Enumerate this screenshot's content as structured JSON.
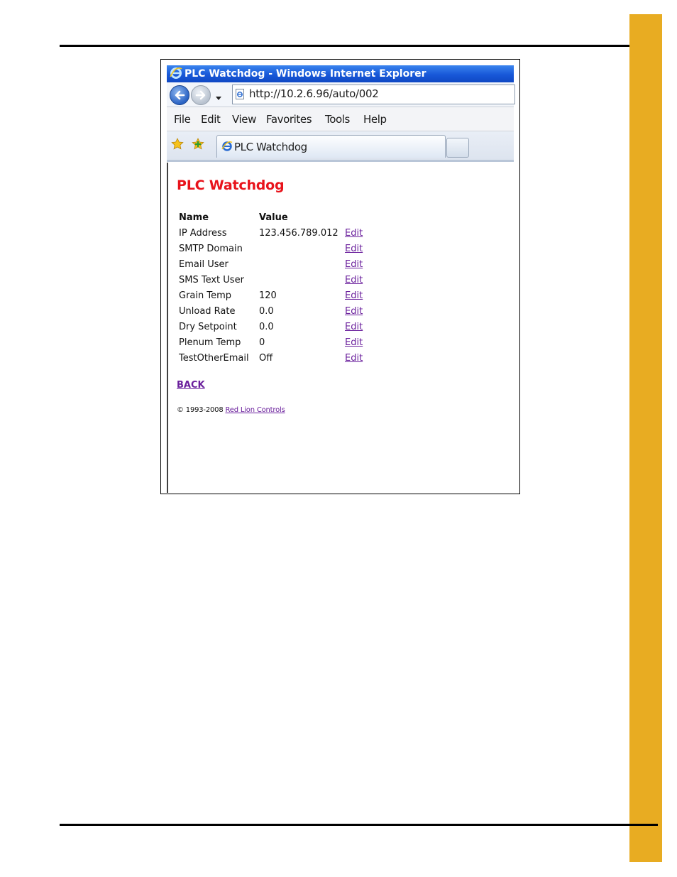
{
  "document": {
    "side_tab_color": "#e8ac22"
  },
  "window": {
    "title": "PLC Watchdog - Windows Internet Explorer"
  },
  "address_bar": {
    "url": "http://10.2.6.96/auto/002"
  },
  "menu": {
    "items": [
      {
        "label": "File"
      },
      {
        "label": "Edit"
      },
      {
        "label": "View"
      },
      {
        "label": "Favorites"
      },
      {
        "label": "Tools"
      },
      {
        "label": "Help"
      }
    ]
  },
  "tabs": {
    "active_label": "PLC Watchdog"
  },
  "page": {
    "title": "PLC Watchdog",
    "title_color": "#e8131b",
    "table": {
      "headers": {
        "name": "Name",
        "value": "Value"
      },
      "rows": [
        {
          "name": "IP Address",
          "value": "123.456.789.012",
          "action": "Edit"
        },
        {
          "name": "SMTP Domain",
          "value": "",
          "action": "Edit"
        },
        {
          "name": "Email User",
          "value": "",
          "action": "Edit"
        },
        {
          "name": "SMS Text User",
          "value": "",
          "action": "Edit"
        },
        {
          "name": "Grain Temp",
          "value": "120",
          "action": "Edit"
        },
        {
          "name": "Unload Rate",
          "value": "0.0",
          "action": "Edit"
        },
        {
          "name": "Dry Setpoint",
          "value": "0.0",
          "action": "Edit"
        },
        {
          "name": "Plenum Temp",
          "value": "0",
          "action": "Edit"
        },
        {
          "name": "TestOtherEmail",
          "value": "Off",
          "action": "Edit"
        }
      ]
    },
    "back_label": "BACK",
    "footer": {
      "copyright": "© 1993-2008",
      "brand": "Red Lion Controls"
    }
  }
}
